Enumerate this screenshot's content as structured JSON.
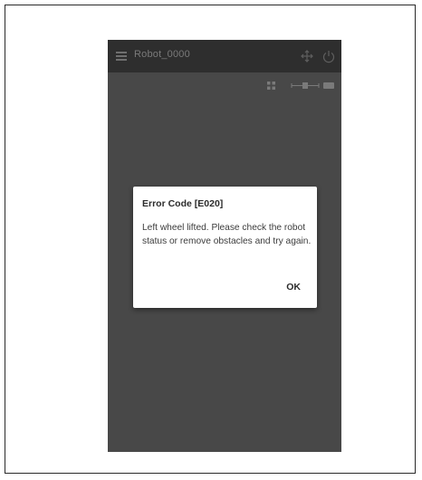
{
  "app_bar": {
    "title": "Robot_0000",
    "menu_icon": "hamburger-menu-icon",
    "move_icon": "move-arrows-icon",
    "power_icon": "power-icon"
  },
  "status_bar": {
    "icons": [
      "grid-icon",
      "slider-icon",
      "battery-icon"
    ]
  },
  "dialog": {
    "title": "Error Code [E020]",
    "message": "Left wheel lifted. Please check the robot status or remove obstacles and try again.",
    "ok_label": "OK"
  },
  "colors": {
    "screen_background": "#484848",
    "app_bar_background": "#2e2e2e",
    "dialog_background": "#ffffff"
  }
}
